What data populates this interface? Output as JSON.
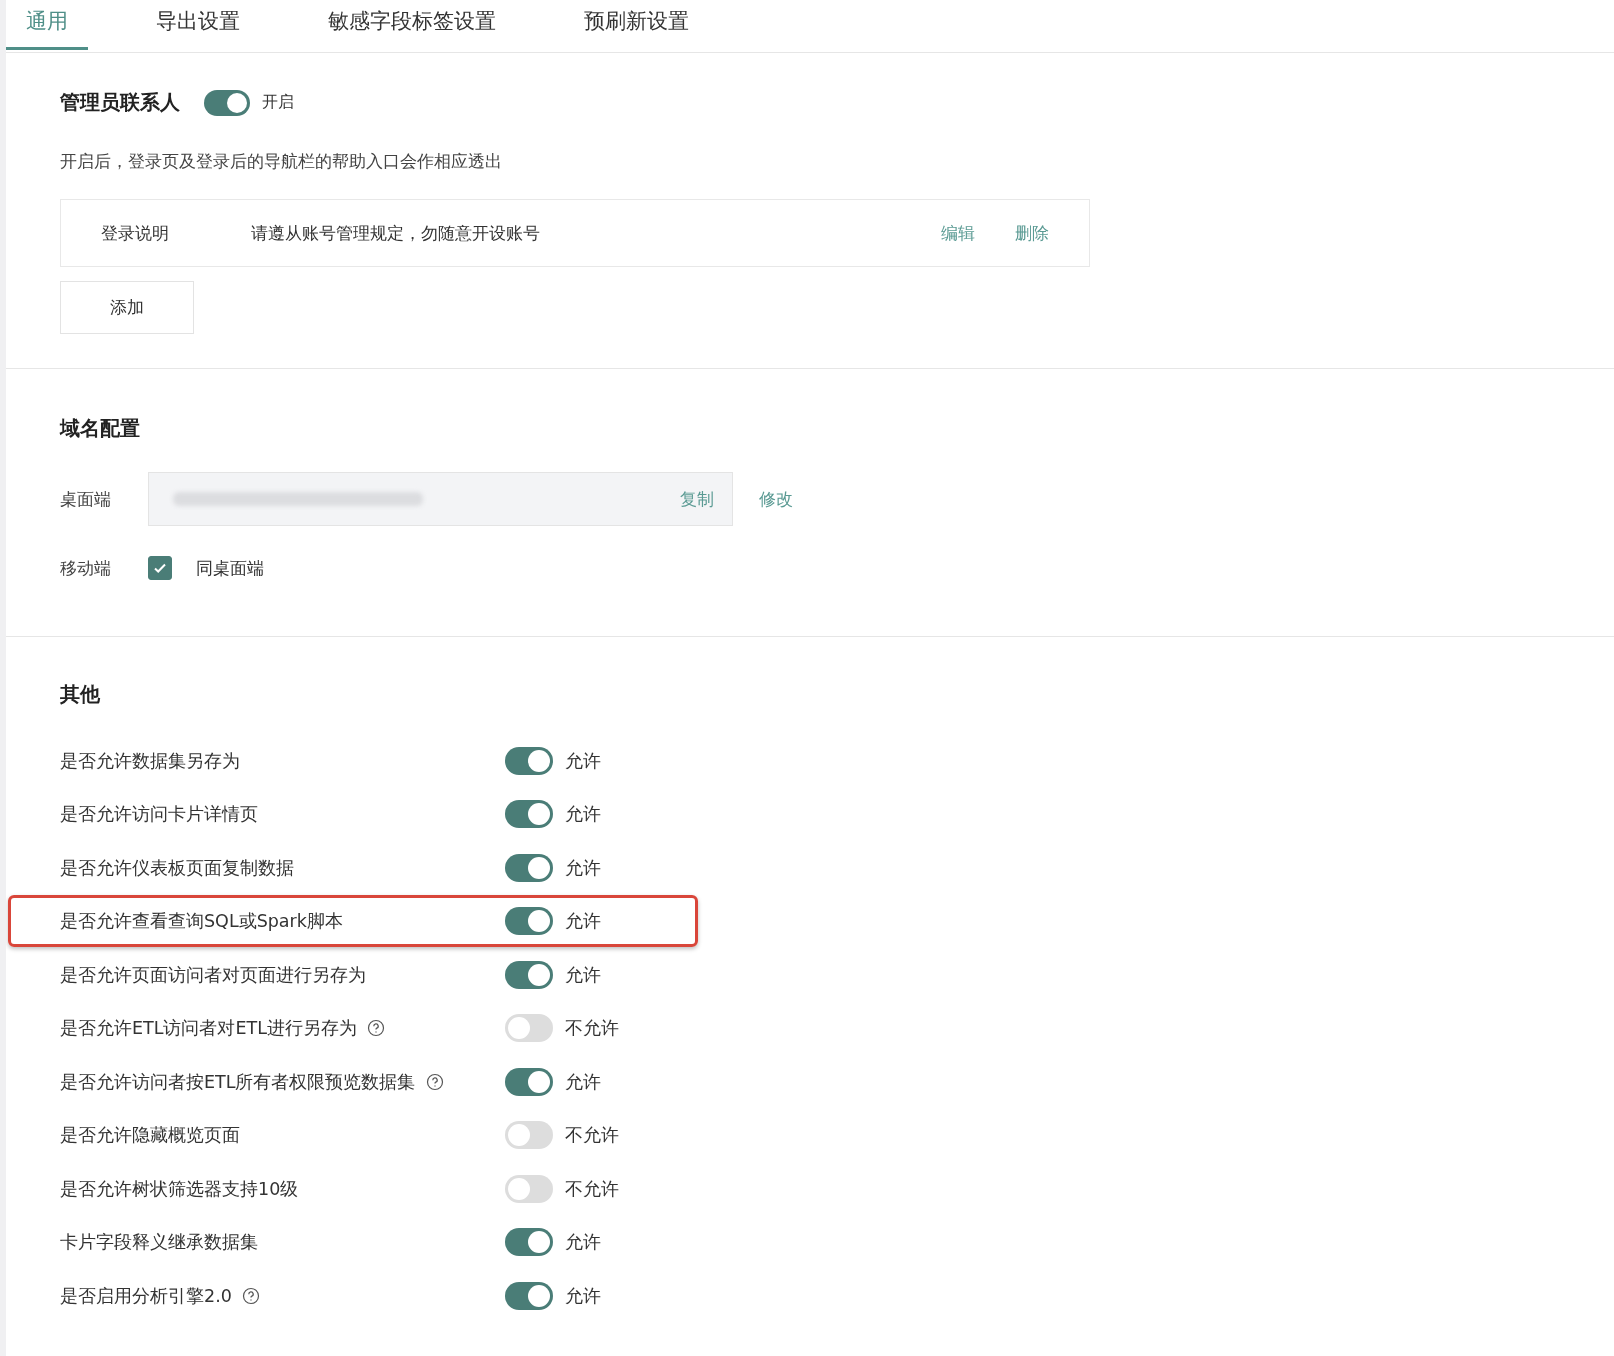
{
  "tabs": [
    {
      "label": "通用",
      "selected": true
    },
    {
      "label": "导出设置",
      "selected": false
    },
    {
      "label": "敏感字段标签设置",
      "selected": false
    },
    {
      "label": "预刷新设置",
      "selected": false
    }
  ],
  "admin_contact": {
    "title": "管理员联系人",
    "on": true,
    "state_label": "开启",
    "description": "开启后，登录页及登录后的导航栏的帮助入口会作相应透出",
    "entries": [
      {
        "name": "登录说明",
        "content": "请遵从账号管理规定，勿随意开设账号",
        "actions": [
          "编辑",
          "删除"
        ]
      }
    ],
    "add_button": "添加"
  },
  "domain": {
    "title": "域名配置",
    "desktop_label": "桌面端",
    "copy_action": "复制",
    "edit_action": "修改",
    "mobile_label": "移动端",
    "mobile_same": {
      "checked": true,
      "label": "同桌面端"
    }
  },
  "other": {
    "title": "其他",
    "rows": [
      {
        "label": "是否允许数据集另存为",
        "help": false,
        "on": true,
        "state_label": "允许",
        "highlighted": false
      },
      {
        "label": "是否允许访问卡片详情页",
        "help": false,
        "on": true,
        "state_label": "允许",
        "highlighted": false
      },
      {
        "label": "是否允许仪表板页面复制数据",
        "help": false,
        "on": true,
        "state_label": "允许",
        "highlighted": false
      },
      {
        "label": "是否允许查看查询SQL或Spark脚本",
        "help": false,
        "on": true,
        "state_label": "允许",
        "highlighted": true
      },
      {
        "label": "是否允许页面访问者对页面进行另存为",
        "help": false,
        "on": true,
        "state_label": "允许",
        "highlighted": false
      },
      {
        "label": "是否允许ETL访问者对ETL进行另存为",
        "help": true,
        "on": false,
        "state_label": "不允许",
        "highlighted": false
      },
      {
        "label": "是否允许访问者按ETL所有者权限预览数据集",
        "help": true,
        "on": true,
        "state_label": "允许",
        "highlighted": false
      },
      {
        "label": "是否允许隐藏概览页面",
        "help": false,
        "on": false,
        "state_label": "不允许",
        "highlighted": false
      },
      {
        "label": "是否允许树状筛选器支持10级",
        "help": false,
        "on": false,
        "state_label": "不允许",
        "highlighted": false
      },
      {
        "label": "卡片字段释义继承数据集",
        "help": false,
        "on": true,
        "state_label": "允许",
        "highlighted": false
      },
      {
        "label": "是否启用分析引擎2.0",
        "help": true,
        "on": true,
        "state_label": "允许",
        "highlighted": false
      }
    ]
  }
}
